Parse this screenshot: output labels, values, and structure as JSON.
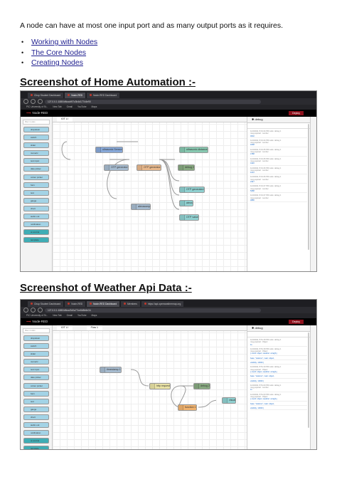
{
  "intro": "A node can have at most one input port and as many output ports as it requires.",
  "links": [
    "Working with Nodes",
    "The Core Nodes",
    "Creating Nodes"
  ],
  "heading1": "Screenshot  of Home Automation :-",
  "heading2": "Screenshot  of Weather Api Data :-",
  "browser": {
    "bookmarks": [
      "PIC University of St...",
      "New Tab",
      "Gmail",
      "YouTube",
      "Maps"
    ],
    "app_name": "Node-RED",
    "deploy": "Deploy",
    "debug": "debug",
    "filter": "filter nodes"
  },
  "shot1": {
    "tabs": [
      "Chup Student Dashboard",
      "Node-RED",
      "Node-RED Dashboard"
    ],
    "url": "127.0.0.1:1880/#flow/d97c3b4d177d4e90",
    "flow_tabs": [
      "IOT LI"
    ],
    "palette": [
      "dropdown",
      "switch",
      "slider",
      "numeric",
      "text input",
      "date picker",
      "colour picker",
      "form",
      "text",
      "gauge",
      "chart",
      "audio out",
      "notification",
      "ui control",
      "template"
    ],
    "nodes": [
      {
        "label": "ultrasonic Sensor",
        "color": "#87a8d8"
      },
      {
        "label": "ultrasonic distance",
        "color": "#87c8b0"
      },
      {
        "label": "OTP generator",
        "color": "#a6bbcf"
      },
      {
        "label": "OTP generator",
        "color": "#e8b88c"
      },
      {
        "label": "debug 2",
        "color": "#87a980"
      },
      {
        "label": "OTP generated",
        "color": "#8fd0d0"
      },
      {
        "label": "alexacomp",
        "color": "#a6bbcf"
      },
      {
        "label": "alexa",
        "color": "#8fd0d0"
      },
      {
        "label": "OTP value",
        "color": "#8fd0d0"
      }
    ],
    "msgs": [
      "11/4/2022, 8:01:44 PM  node: debug 1",
      "msg.payload : number",
      "0002",
      "11/4/2022, 8:01:44 PM  node: debug 1",
      "msg.payload : number",
      "1808",
      "11/4/2022, 8:01:45 PM  node: debug 1",
      "msg.payload : number",
      "4788",
      "11/4/2022, 8:01:45 PM  node: debug 1",
      "msg.payload : number",
      "0140",
      "11/4/2022, 8:01:46 PM  node: debug 1",
      "msg.payload : number",
      "1012",
      "11/4/2022, 8:01:46 PM  node: debug 1",
      "msg.payload : number",
      "2347",
      "11/4/2022, 8:01:47 PM  node: debug 1",
      "msg.payload : number",
      "5088",
      "11/4/2022, 8:01:47 PM  node: debug 1",
      "msg.payload : number",
      "3880"
    ]
  },
  "shot2": {
    "tabs": [
      "Chup Student Dashboard",
      "Node-RED",
      "Node-RED Dashboard",
      "Members",
      "https://api.openweathermap.org"
    ],
    "url": "127.0.0.1:1880/#flow/2d0a77ce8d5b6e34",
    "flow_tabs": [
      "IOT LI",
      "Flow 1"
    ],
    "palette": [
      "dropdown",
      "switch",
      "slider",
      "numeric",
      "text input",
      "date picker",
      "colour picker",
      "form",
      "text",
      "gauge",
      "chart",
      "audio out",
      "notification",
      "ui control",
      "template"
    ],
    "nodes": [
      {
        "label": "timestamp 1",
        "color": "#a6bbcf"
      },
      {
        "label": "http request",
        "color": "#e9e2a5"
      },
      {
        "label": "debug 2",
        "color": "#87a980"
      },
      {
        "label": "function 1",
        "color": "#f0b26e"
      },
      {
        "label": "visual",
        "color": "#8fd0d0"
      }
    ],
    "msgs": [
      "11/4/2022, 8:51:18 PM  node: debug 1",
      "msg.payload : Object",
      "11",
      "11/4/2022, 8:51:18 PM  node: debug 1",
      "msg.payload : Object",
      "{ coord: object, weather: array[1],",
      "base: \"stations\", main: object,",
      "visibility: 10000 }",
      "11/4/2022, 8:51:19 PM  node: debug 1",
      "msg.payload : Object",
      "{ coord: object, weather: array[1],",
      "base: \"stations\", main: object,",
      "visibility: 10000 }",
      "11/4/2022, 8:51:20 PM  node: debug 1",
      "msg.payload : number",
      "11",
      "11/4/2022, 8:51:20 PM  node: debug 1",
      "msg.payload : Object",
      "{ coord: object, weather: array[1],",
      "base: \"stations\", main: object,",
      "visibility: 10000 }"
    ]
  }
}
